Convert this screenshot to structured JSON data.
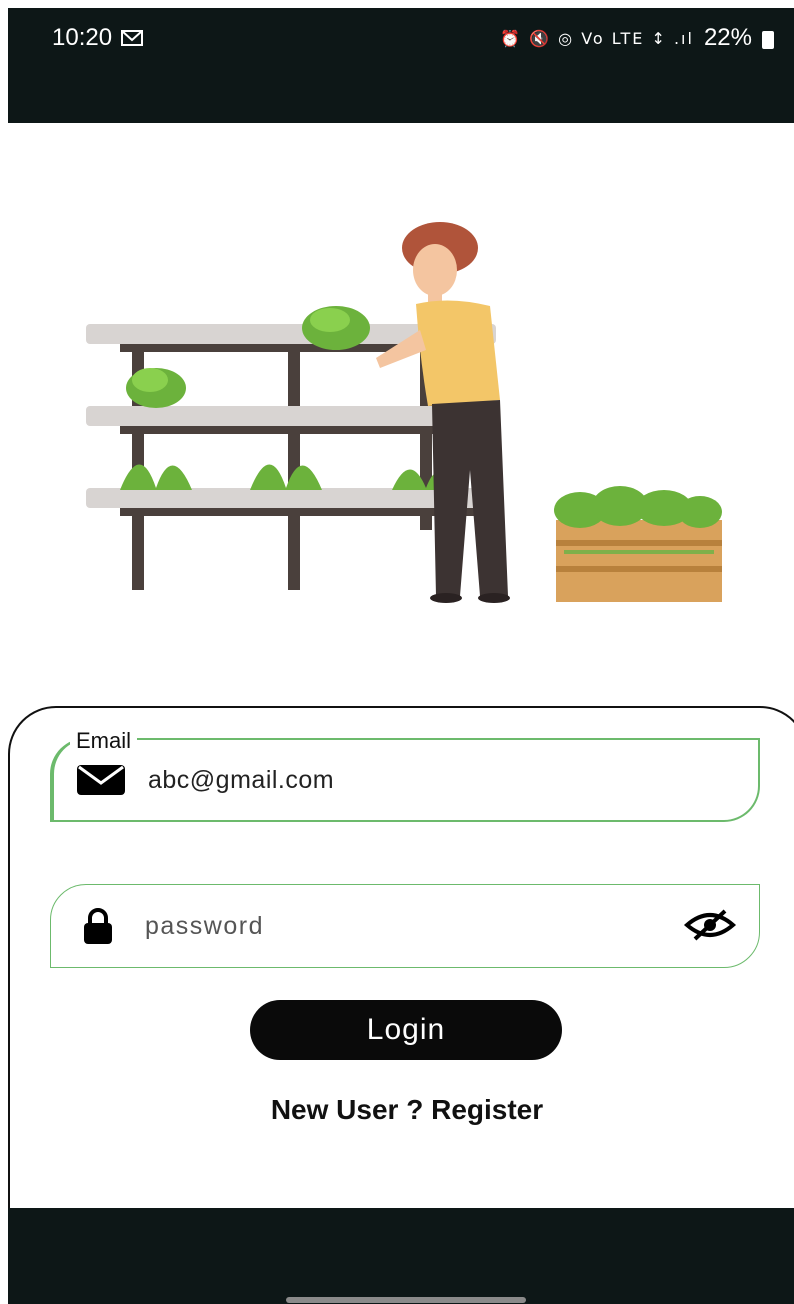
{
  "status_bar": {
    "time": "10:20",
    "notification_icon": "gmail-icon",
    "indicators": "⏰ 🔇 ◎ Vo LTE ↕ .ıl",
    "battery": "22%"
  },
  "illustration": {
    "icon": "hydroponic-farming-illustration"
  },
  "login": {
    "email_label": "Email",
    "email_value": "abc@gmail.com",
    "password_placeholder": "password",
    "login_label": "Login",
    "register_text": "New User ? Register"
  },
  "colors": {
    "accent_green": "#6cba6c",
    "bar_dark": "#0d1717",
    "button_black": "#0a0a0a"
  }
}
